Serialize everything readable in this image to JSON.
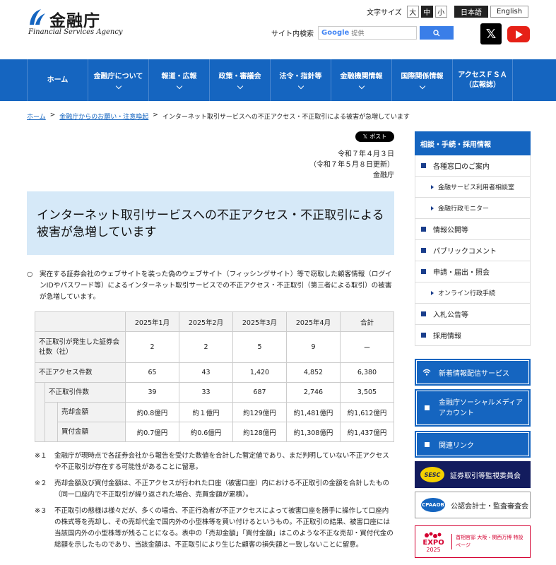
{
  "header": {
    "logo_jp": "金融庁",
    "logo_en": "Financial Services Agency",
    "font_size_label": "文字サイズ",
    "font_sizes": [
      "大",
      "中",
      "小"
    ],
    "languages": [
      "日本語",
      "English"
    ],
    "search_label": "サイト内検索",
    "search_google": "Google",
    "search_placeholder": "提供"
  },
  "nav": {
    "items": [
      {
        "label": "ホーム",
        "has_menu": false
      },
      {
        "label": "金融庁について",
        "has_menu": true
      },
      {
        "label": "報道・広報",
        "has_menu": true
      },
      {
        "label": "政策・審議会",
        "has_menu": true
      },
      {
        "label": "法令・指針等",
        "has_menu": true
      },
      {
        "label": "金融機関情報",
        "has_menu": true
      },
      {
        "label": "国際関係情報",
        "has_menu": true
      },
      {
        "label": "アクセスＦＳＡ\n（広報誌）",
        "has_menu": false
      }
    ]
  },
  "breadcrumb": {
    "home": "ホーム",
    "parent": "金融庁からのお願い・注意喚起",
    "current": "インターネット取引サービスへの不正アクセス・不正取引による被害が急増しています",
    "sep": ">"
  },
  "article": {
    "post_button": "ポスト",
    "date": "令和７年４月３日",
    "updated": "（令和７年５月８日更新）",
    "author": "金融庁",
    "title": "インターネット取引サービスへの不正アクセス・不正取引による被害が急増しています",
    "lead": "○　実在する証券会社のウェブサイトを装った偽のウェブサイト（フィッシングサイト）等で窃取した顧客情報（ログインIDやパスワード等）によるインターネット取引サービスでの不正アクセス・不正取引（第三者による取引）の被害が急増しています。",
    "table": {
      "headers": [
        "2025年1月",
        "2025年2月",
        "2025年3月",
        "2025年4月",
        "合計"
      ],
      "rows": [
        {
          "label": "不正取引が発生した証券会社数（社）",
          "values": [
            "2",
            "2",
            "5",
            "9",
            "ー"
          ]
        },
        {
          "label": "不正アクセス件数",
          "values": [
            "65",
            "43",
            "1,420",
            "4,852",
            "6,380"
          ]
        },
        {
          "label": "不正取引件数",
          "values": [
            "39",
            "33",
            "687",
            "2,746",
            "3,505"
          ]
        },
        {
          "label": "売却金額",
          "values": [
            "約0.8億円",
            "約１億円",
            "約129億円",
            "約1,481億円",
            "約1,612億円"
          ]
        },
        {
          "label": "買付金額",
          "values": [
            "約0.7億円",
            "約0.6億円",
            "約128億円",
            "約1,308億円",
            "約1,437億円"
          ]
        }
      ]
    },
    "notes": [
      {
        "mark": "※１",
        "text": "金融庁が現時点で各証券会社から報告を受けた数値を合計した暫定値であり、まだ判明していない不正アクセスや不正取引が存在する可能性があることに留意。"
      },
      {
        "mark": "※２",
        "text": "売却金額及び買付金額は、不正アクセスが行われた口座（被害口座）内における不正取引の金額を合計したもの（同一口座内で不正取引が繰り返された場合、売買金額が累積）。"
      },
      {
        "mark": "※３",
        "text": "不正取引の態様は様々だが、多くの場合、不正行為者が不正アクセスによって被害口座を勝手に操作して口座内の株式等を売却し、その売却代金で国内外の小型株等を買い付けるというもの。不正取引の結果、被害口座には当該国内外の小型株等が残ることになる。表中の「売却金額」「買付金額」はこのような不正な売却・買付代金の総額を示したものであり、当該金額は、不正取引により生じた顧客の損失額と一致しないことに留意。"
      }
    ]
  },
  "sidebar": {
    "heading": "相談・手続・採用情報",
    "items": [
      {
        "label": "各種窓口のご案内",
        "type": "main"
      },
      {
        "label": "金融サービス利用者相談室",
        "type": "sub"
      },
      {
        "label": "金融行政モニター",
        "type": "sub"
      },
      {
        "label": "情報公開等",
        "type": "main"
      },
      {
        "label": "パブリックコメント",
        "type": "main"
      },
      {
        "label": "申請・届出・照会",
        "type": "main"
      },
      {
        "label": "オンライン行政手続",
        "type": "sub"
      },
      {
        "label": "入札公告等",
        "type": "main"
      },
      {
        "label": "採用情報",
        "type": "main"
      }
    ],
    "rss": "新着情報配信サービス",
    "social": "金融庁ソーシャルメディアアカウント",
    "related": "関連リンク",
    "sesc_badge": "SESC",
    "sesc": "証券取引等監視委員会",
    "cpa_badge": "CPAAOB",
    "cpa": "公認会計士・監査審査会",
    "expo_logo": "EXPO",
    "expo_year": "2025",
    "expo_text": "首相官邸 大阪・関西万博 特設ページ"
  }
}
